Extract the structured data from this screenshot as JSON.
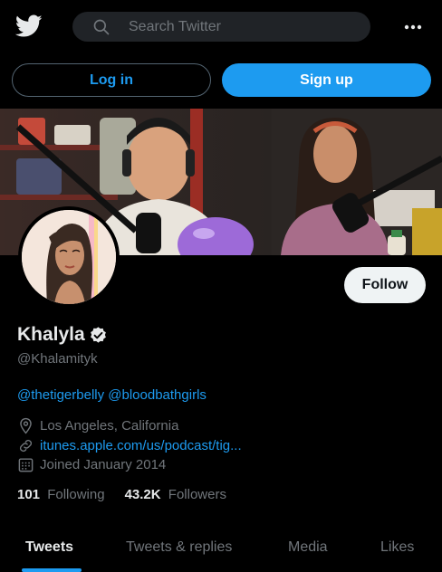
{
  "search": {
    "placeholder": "Search Twitter"
  },
  "auth": {
    "login_label": "Log in",
    "signup_label": "Sign up"
  },
  "profile": {
    "name": "Khalyla",
    "handle": "@Khalamityk",
    "bio_mentions": [
      "@thetigerbelly",
      "@bloodbathgirls"
    ],
    "location": "Los Angeles, California",
    "website": "itunes.apple.com/us/podcast/tig...",
    "joined": "Joined January 2014",
    "following_count": "101",
    "following_label": "Following",
    "followers_count": "43.2K",
    "followers_label": "Followers",
    "follow_label": "Follow"
  },
  "tabs": [
    {
      "label": "Tweets",
      "active": true
    },
    {
      "label": "Tweets & replies",
      "active": false
    },
    {
      "label": "Media",
      "active": false
    },
    {
      "label": "Likes",
      "active": false
    }
  ],
  "colors": {
    "accent": "#1d9bf0",
    "background": "#000000",
    "muted": "#71767b",
    "text": "#e7e9ea"
  },
  "icons": [
    "twitter-bird-icon",
    "search-icon",
    "more-icon",
    "verified-badge-icon",
    "location-icon",
    "link-icon",
    "calendar-icon"
  ]
}
